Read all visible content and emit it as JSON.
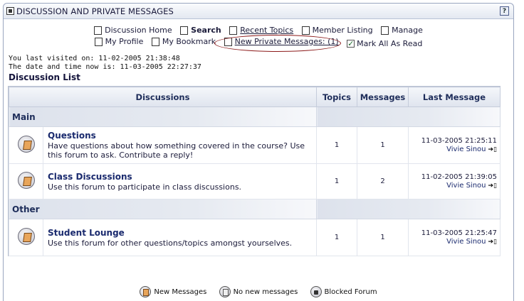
{
  "window": {
    "title": "DISCUSSION AND PRIVATE MESSAGES",
    "help": "?"
  },
  "nav": {
    "row1": [
      {
        "label": "Discussion Home",
        "icon": "home-icon"
      },
      {
        "label": "Search",
        "icon": "search-icon"
      },
      {
        "label": "Recent Topics",
        "icon": "recent-topics-icon"
      },
      {
        "label": "Member Listing",
        "icon": "member-listing-icon"
      },
      {
        "label": "Manage",
        "icon": "manage-icon"
      }
    ],
    "row2": [
      {
        "label": "My Profile",
        "icon": "profile-icon"
      },
      {
        "label": "My Bookmark",
        "icon": "bookmark-icon"
      },
      {
        "label": "New Private Messages: (1)",
        "icon": "private-messages-icon"
      },
      {
        "label": "Mark All As Read",
        "icon": "checkmark-icon"
      }
    ]
  },
  "info": {
    "last_visit": "You last visited on: 11-02-2005 21:38:48",
    "now": "The date and time now is: 11-03-2005 22:27:37"
  },
  "list_title": "Discussion List",
  "table": {
    "headers": {
      "discussions": "Discussions",
      "topics": "Topics",
      "messages": "Messages",
      "last": "Last Message"
    },
    "categories": [
      {
        "name": "Main",
        "forums": [
          {
            "name": "Questions",
            "desc": "Have questions about how something covered in the course? Use this forum to ask. Contribute a reply!",
            "topics": "1",
            "messages": "1",
            "last_date": "11-03-2005 21:25:11",
            "last_user": "Vivie Sinou"
          },
          {
            "name": "Class Discussions",
            "desc": "Use this forum to participate in class discussions.",
            "topics": "1",
            "messages": "2",
            "last_date": "11-02-2005 21:39:05",
            "last_user": "Vivie Sinou"
          }
        ]
      },
      {
        "name": "Other",
        "forums": [
          {
            "name": "Student Lounge",
            "desc": "Use this forum for other questions/topics amongst yourselves.",
            "topics": "1",
            "messages": "1",
            "last_date": "11-03-2005 21:25:47",
            "last_user": "Vivie Sinou"
          }
        ]
      }
    ]
  },
  "legend": {
    "new": "New Messages",
    "no_new": "No new messages",
    "blocked": "Blocked Forum"
  }
}
